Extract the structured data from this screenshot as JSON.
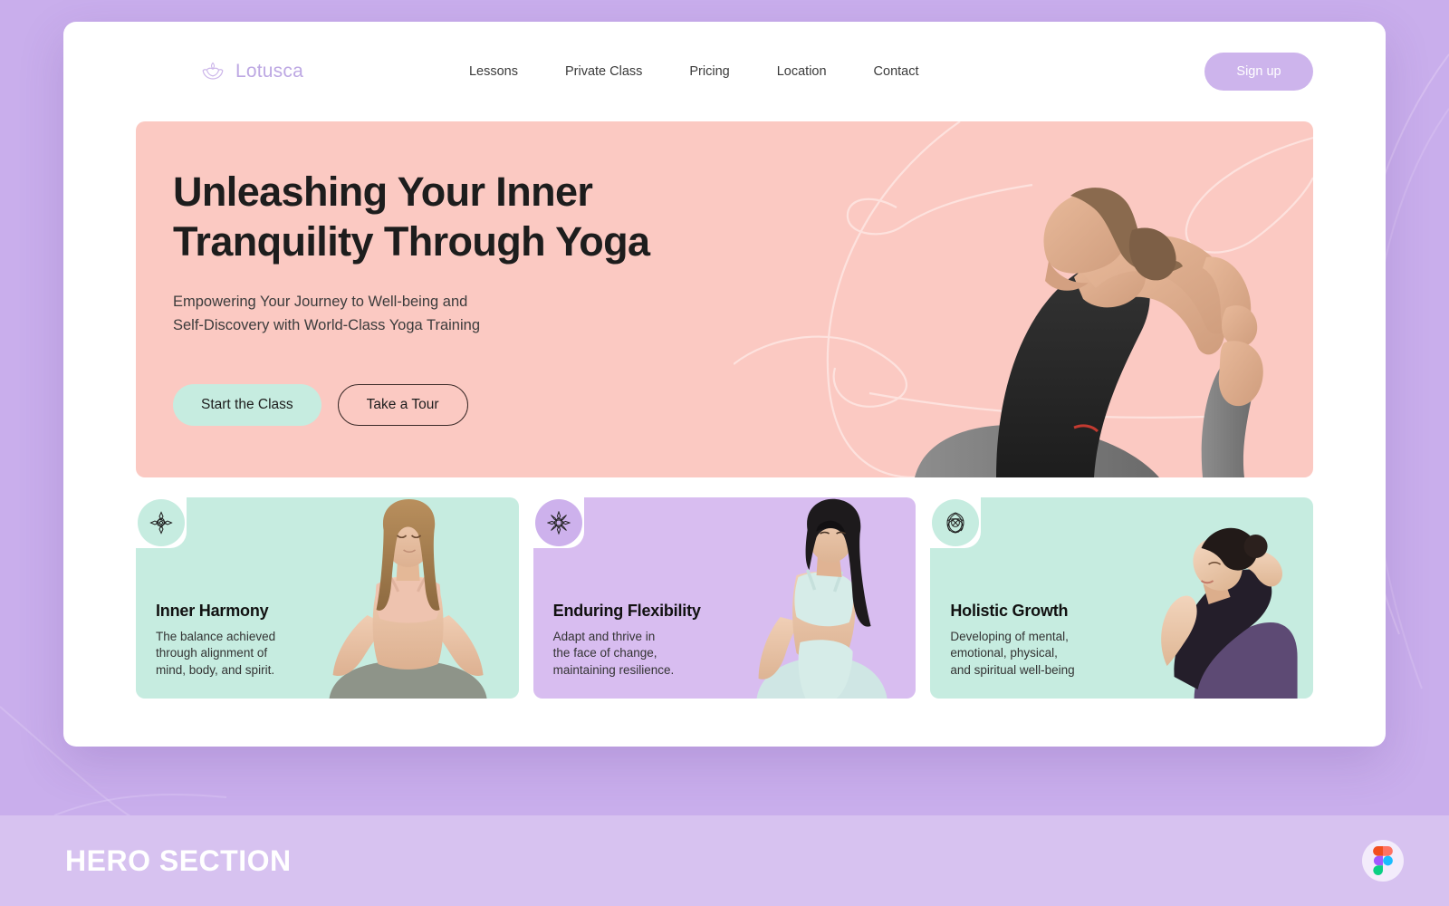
{
  "page": {
    "background_color": "#c9aeec",
    "card_background": "#ffffff"
  },
  "header": {
    "brand": {
      "icon": "lotus-icon",
      "name": "Lotusca",
      "color": "#bda8e3"
    },
    "nav_items": [
      {
        "label": "Lessons"
      },
      {
        "label": "Private Class"
      },
      {
        "label": "Pricing"
      },
      {
        "label": "Location"
      },
      {
        "label": "Contact"
      }
    ],
    "signup": {
      "label": "Sign up",
      "color": "#cdb4ec"
    }
  },
  "hero": {
    "background_color": "#fbc9c2",
    "title": "Unleashing Your Inner Tranquility Through Yoga",
    "subtitle_line1": "Empowering Your Journey to Well-being and",
    "subtitle_line2": "Self-Discovery with World-Class Yoga Training",
    "primary_cta": {
      "label": "Start the Class",
      "color": "#c6ece0"
    },
    "secondary_cta": {
      "label": "Take a Tour"
    },
    "image_alt": "woman-in-king-pigeon-yoga-pose"
  },
  "features": [
    {
      "icon": "mandala-compass-icon",
      "title": "Inner Harmony",
      "desc_lines": [
        "The balance achieved",
        "through alignment of",
        "mind, body, and spirit."
      ],
      "background_color": "#c6ece0",
      "badge_color": "#c6ece0",
      "image_alt": "woman-meditating-lotus-pose"
    },
    {
      "icon": "mandala-star-icon",
      "title": "Enduring Flexibility",
      "desc_lines": [
        "Adapt and thrive in",
        "the face of change,",
        "maintaining resilience."
      ],
      "background_color": "#d8bdf0",
      "badge_color": "#cdb1ec",
      "image_alt": "woman-seated-twist-pose"
    },
    {
      "icon": "mandala-rose-icon",
      "title": "Holistic Growth",
      "desc_lines": [
        "Developing of mental,",
        "emotional, physical,",
        "and spiritual well-being"
      ],
      "background_color": "#c6ece0",
      "badge_color": "#c6ece0",
      "image_alt": "woman-side-bend-pose"
    }
  ],
  "footer": {
    "label": "HERO SECTION",
    "background_color": "#d7c2f0",
    "badge_icon": "figma-logo-icon"
  }
}
